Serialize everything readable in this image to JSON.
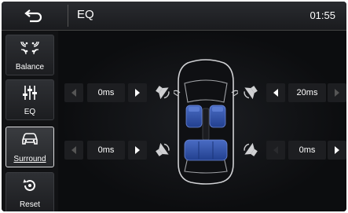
{
  "header": {
    "title": "EQ",
    "time": "01:55"
  },
  "sidebar": {
    "items": [
      {
        "label": "Balance",
        "icon": "balance-icon",
        "active": false
      },
      {
        "label": "EQ",
        "icon": "eq-sliders-icon",
        "active": false
      },
      {
        "label": "Surround",
        "icon": "car-icon",
        "active": true
      },
      {
        "label": "Reset",
        "icon": "reset-icon",
        "active": false
      }
    ]
  },
  "delays": {
    "front_left": "0ms",
    "front_right": "20ms",
    "rear_left": "0ms",
    "rear_right": "0ms"
  },
  "colors": {
    "seat": "#2d4fa8",
    "accent": "#ffffff",
    "background": "#0c0d0f"
  }
}
